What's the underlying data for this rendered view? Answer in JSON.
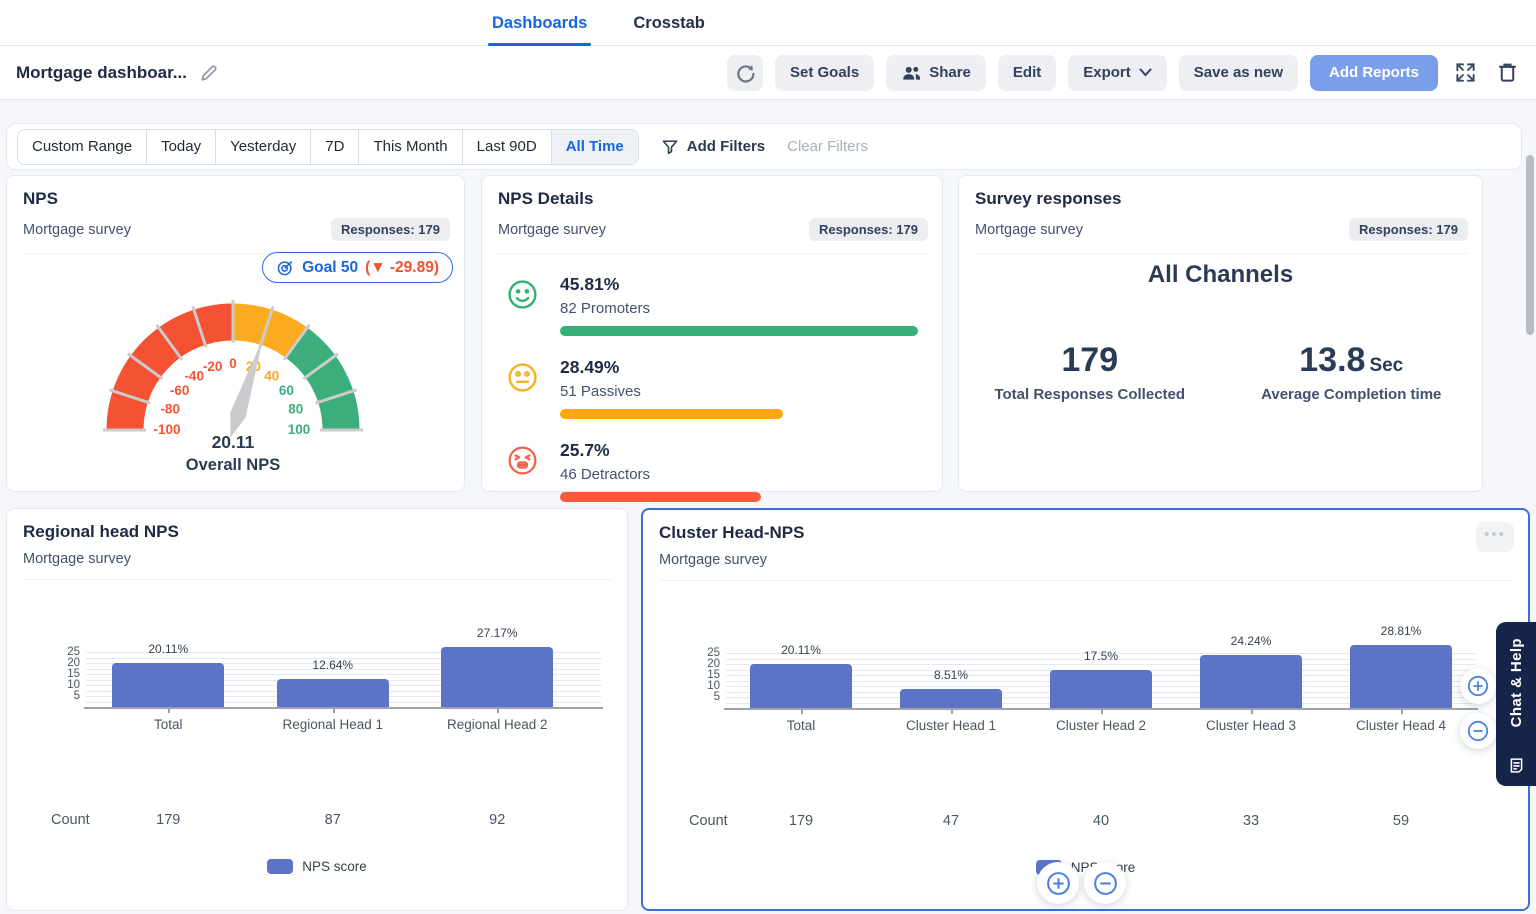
{
  "colors": {
    "accent_blue": "#1566E0",
    "add_reports_blue": "#7B9EEA",
    "bar_blue": "#5B74C8",
    "green": "#35AF76",
    "yellow": "#FFA70D",
    "red": "#F85B3C",
    "gauge_red": "#F55234",
    "gauge_orange": "#FAAB1E",
    "gauge_green": "#3BAE7C",
    "card_selected_border": "#3B6FD6"
  },
  "header": {
    "tabs": [
      {
        "label": "Dashboards",
        "active": true
      },
      {
        "label": "Crosstab",
        "active": false
      }
    ]
  },
  "toolbar": {
    "title": "Mortgage dashboar...",
    "set_goals": "Set Goals",
    "share": "Share",
    "edit": "Edit",
    "export": "Export",
    "save_as_new": "Save as new",
    "add_reports": "Add Reports"
  },
  "filters": {
    "ranges": [
      "Custom Range",
      "Today",
      "Yesterday",
      "7D",
      "This Month",
      "Last 90D",
      "All Time"
    ],
    "active_range": "All Time",
    "add_filters": "Add Filters",
    "clear_filters": "Clear Filters"
  },
  "cards": {
    "nps": {
      "title": "NPS",
      "subtitle": "Mortgage survey",
      "responses_badge": "Responses: 179",
      "goal_label": "Goal 50",
      "goal_delta_label": "(▼ -29.89)",
      "value_label": "20.11",
      "caption": "Overall NPS"
    },
    "nps_details": {
      "title": "NPS Details",
      "subtitle": "Mortgage survey",
      "responses_badge": "Responses: 179"
    },
    "survey_responses": {
      "title": "Survey responses",
      "subtitle": "Mortgage survey",
      "responses_badge": "Responses: 179",
      "heading": "All Channels",
      "total_value": "179",
      "total_label": "Total Responses Collected",
      "avg_value": "13.8",
      "avg_unit": "Sec",
      "avg_label": "Average Completion time"
    },
    "regional": {
      "title": "Regional head NPS",
      "subtitle": "Mortgage survey"
    },
    "cluster": {
      "title": "Cluster Head-NPS",
      "subtitle": "Mortgage survey"
    }
  },
  "side_widget": {
    "label": "Chat & Help"
  },
  "chart_data": [
    {
      "id": "nps-gauge",
      "type": "gauge",
      "title": "NPS",
      "value": 20.11,
      "min": -100,
      "max": 100,
      "caption": "Overall NPS",
      "goal": 50,
      "goal_delta": -29.89,
      "ticks": [
        -100,
        -80,
        -60,
        -40,
        -20,
        0,
        20,
        40,
        60,
        80,
        100
      ],
      "segments": [
        {
          "from": -100,
          "to": 0,
          "color": "#F55234"
        },
        {
          "from": 0,
          "to": 40,
          "color": "#FAAB1E"
        },
        {
          "from": 40,
          "to": 100,
          "color": "#3BAE7C"
        }
      ]
    },
    {
      "id": "nps-details",
      "type": "bar",
      "title": "NPS Details",
      "rows": [
        {
          "pct": 45.81,
          "pct_label": "45.81%",
          "label": "82 Promoters",
          "count": 82,
          "color": "#35AF76"
        },
        {
          "pct": 28.49,
          "pct_label": "28.49%",
          "label": "51 Passives",
          "count": 51,
          "color": "#FFA70D"
        },
        {
          "pct": 25.7,
          "pct_label": "25.7%",
          "label": "46 Detractors",
          "count": 46,
          "color": "#F85B3C"
        }
      ]
    },
    {
      "id": "regional-head-nps",
      "type": "bar",
      "title": "Regional head NPS",
      "categories": [
        "Total",
        "Regional Head 1",
        "Regional Head 2"
      ],
      "values": [
        20.11,
        12.64,
        27.17
      ],
      "value_labels": [
        "20.11%",
        "12.64%",
        "27.17%"
      ],
      "counts": [
        179,
        87,
        92
      ],
      "count_label": "Count",
      "yticks": [
        5,
        10,
        15,
        20,
        25
      ],
      "ylim": [
        0,
        30
      ],
      "legend": "NPS score",
      "bar_color": "#5B74C8"
    },
    {
      "id": "cluster-head-nps",
      "type": "bar",
      "title": "Cluster Head-NPS",
      "categories": [
        "Total",
        "Cluster Head 1",
        "Cluster Head 2",
        "Cluster Head 3",
        "Cluster Head 4"
      ],
      "values": [
        20.11,
        8.51,
        17.5,
        24.24,
        28.81
      ],
      "value_labels": [
        "20.11%",
        "8.51%",
        "17.5%",
        "24.24%",
        "28.81%"
      ],
      "counts": [
        179,
        47,
        40,
        33,
        59
      ],
      "count_label": "Count",
      "yticks": [
        5,
        10,
        15,
        20,
        25
      ],
      "ylim": [
        0,
        30
      ],
      "legend": "NPS score",
      "bar_color": "#5B74C8"
    }
  ]
}
